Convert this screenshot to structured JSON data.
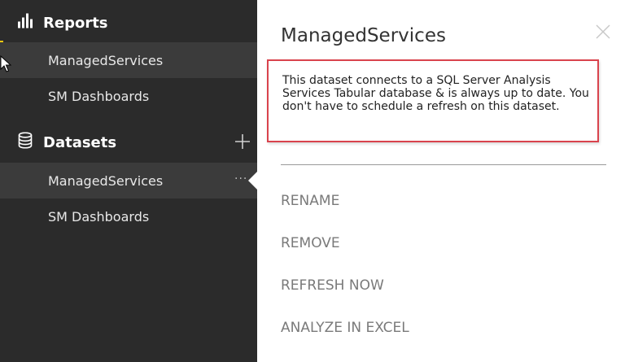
{
  "sidebar": {
    "reports_header": "Reports",
    "reports": [
      {
        "label": "ManagedServices",
        "selected": true
      },
      {
        "label": "SM Dashboards",
        "selected": false
      }
    ],
    "datasets_header": "Datasets",
    "datasets": [
      {
        "label": "ManagedServices",
        "selected": true
      },
      {
        "label": "SM Dashboards",
        "selected": false
      }
    ],
    "icons": {
      "reports": "bar-chart-icon",
      "datasets": "database-icon",
      "add": "plus-icon",
      "more": "ellipsis-icon"
    },
    "accent": "#f2c811"
  },
  "panel": {
    "title": "ManagedServices",
    "description": "This dataset connects to a SQL Server Analysis Services Tabular database & is always up to date. You don't have to schedule a refresh on this dataset.",
    "menu": [
      "RENAME",
      "REMOVE",
      "REFRESH NOW",
      "ANALYZE IN EXCEL"
    ],
    "highlight_color": "#d9434d"
  }
}
